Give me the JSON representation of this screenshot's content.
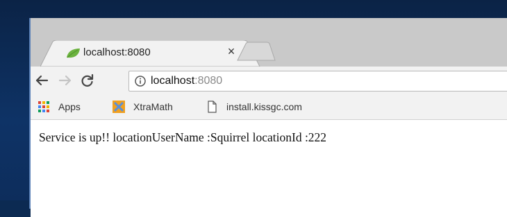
{
  "tab": {
    "title": "localhost:8080",
    "close_glyph": "×",
    "favicon": "leaf-icon"
  },
  "toolbar": {
    "back_glyph": "←",
    "forward_glyph": "→",
    "reload_glyph": "C",
    "address": {
      "host": "localhost",
      "port": ":8080"
    }
  },
  "bookmarks": [
    {
      "label": "Apps",
      "icon": "apps-grid-icon"
    },
    {
      "label": "XtraMath",
      "icon": "xtramath-icon"
    },
    {
      "label": "install.kissgc.com",
      "icon": "page-icon"
    }
  ],
  "page": {
    "body_text": "Service is up!! locationUserName :Squirrel locationId :222"
  },
  "colors": {
    "desktop": "#0c2a52",
    "tabstrip": "#c9c9c9",
    "toolbar": "#f2f2f2",
    "favicon_green": "#6cb33f",
    "xtramath_orange": "#f0a020"
  }
}
